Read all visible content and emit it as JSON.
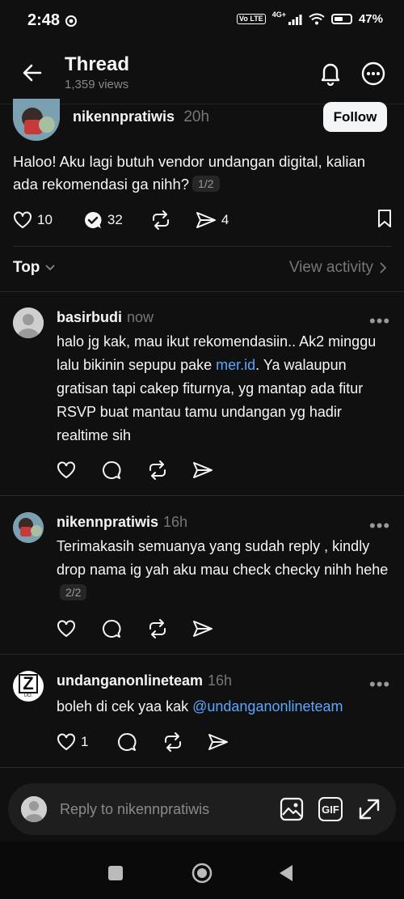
{
  "status_bar": {
    "time": "2:48",
    "network": "4G+",
    "volte": "Vo LTE",
    "battery": "47%"
  },
  "header": {
    "title": "Thread",
    "views": "1,359 views"
  },
  "post": {
    "author": "nikennpratiwis",
    "time": "20h",
    "follow_label": "Follow",
    "text": "Haloo! Aku lagi butuh vendor undangan digital, kalian ada rekomendasi ga nihh?",
    "page_pill": "1/2",
    "likes": "10",
    "reposts": "32",
    "shares": "4"
  },
  "sort": {
    "label": "Top",
    "view_activity": "View activity"
  },
  "comments": [
    {
      "author": "basirbudi",
      "time": "now",
      "text_before": "halo jg kak, mau ikut rekomendasiin.. Ak2 minggu lalu bikinin sepupu pake ",
      "link": "mer.id",
      "text_after": ". Ya walaupun gratisan tapi cakep fiturnya, yg mantap ada fitur RSVP buat mantau tamu undangan yg hadir realtime sih"
    },
    {
      "author": "nikennpratiwis",
      "time": "16h",
      "text": "Terimakasih semuanya yang sudah reply , kindly drop nama ig yah aku mau check checky nihh hehe",
      "page_pill": "2/2"
    },
    {
      "author": "undanganonlineteam",
      "time": "16h",
      "text": "boleh di cek yaa kak ",
      "mention": "@undanganonlineteam",
      "likes": "1",
      "avatar_letter": "Z",
      "avatar_sub": "UO."
    }
  ],
  "reply": {
    "placeholder": "Reply to nikennpratiwis",
    "gif_label": "GIF"
  }
}
